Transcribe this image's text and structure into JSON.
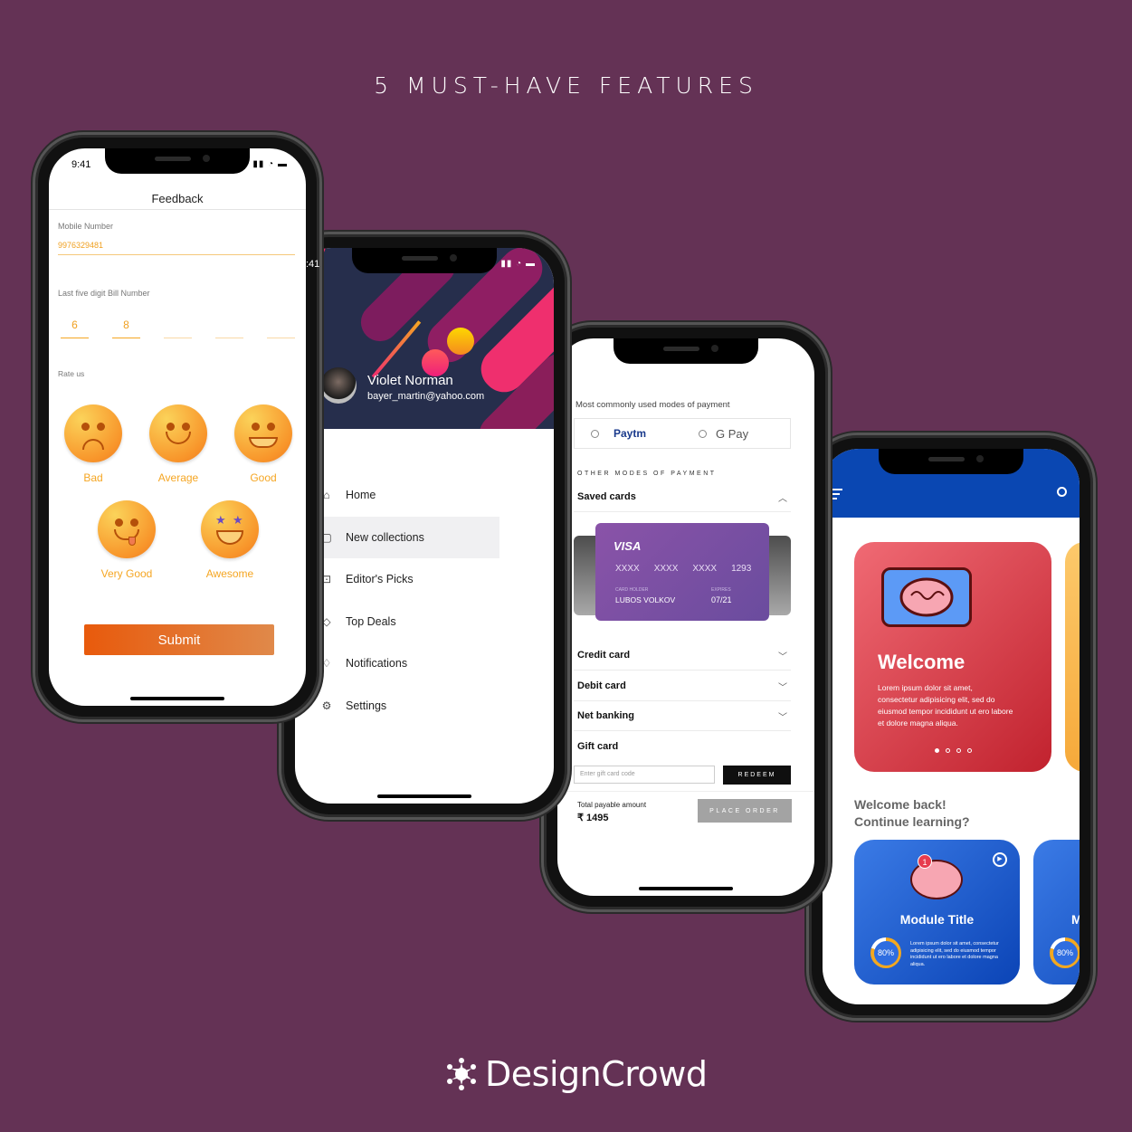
{
  "headline": "5 MUST-HAVE FEATURES",
  "brand": {
    "name": "DesignCrowd",
    "logo_icon": "starburst-people-icon"
  },
  "phone1": {
    "status_time": "9:41",
    "title": "Feedback",
    "mobile_label": "Mobile Number",
    "mobile_value": "9976329481",
    "bill_label": "Last five digit Bill Number",
    "bill_digits": [
      "6",
      "8",
      "",
      "",
      ""
    ],
    "rate_label": "Rate us",
    "ratings": [
      {
        "label": "Bad",
        "icon": "sad-face-icon"
      },
      {
        "label": "Average",
        "icon": "smile-face-icon"
      },
      {
        "label": "Good",
        "icon": "grin-face-icon"
      },
      {
        "label": "Very Good",
        "icon": "tongue-face-icon"
      },
      {
        "label": "Awesome",
        "icon": "star-eyes-face-icon"
      }
    ],
    "submit_label": "Submit",
    "accent": "#f5a623"
  },
  "phone2": {
    "status_time": ":41",
    "user_name": "Violet Norman",
    "user_email": "bayer_martin@yahoo.com",
    "menu": [
      {
        "label": "Home",
        "icon": "home-icon",
        "selected": false
      },
      {
        "label": "New collections",
        "icon": "sticky-note-icon",
        "selected": true
      },
      {
        "label": "Editor's Picks",
        "icon": "inbox-star-icon",
        "selected": false
      },
      {
        "label": "Top Deals",
        "icon": "tag-icon",
        "selected": false
      },
      {
        "label": "Notifications",
        "icon": "bell-icon",
        "selected": false
      },
      {
        "label": "Settings",
        "icon": "gear-icon",
        "selected": false
      }
    ]
  },
  "phone3": {
    "common_label": "Most commonly used modes of payment",
    "quick_options": [
      "Paytm",
      "G Pay"
    ],
    "other_label": "OTHER MODES OF PAYMENT",
    "saved_cards_label": "Saved cards",
    "card": {
      "brand": "VISA",
      "number": [
        "XXXX",
        "XXXX",
        "XXXX",
        "1293"
      ],
      "holder_label": "CARD HOLDER",
      "holder": "LUBOS VOLKOV",
      "expires_label": "EXPIRES",
      "expires": "07/21"
    },
    "sections": [
      "Credit card",
      "Debit card",
      "Net banking"
    ],
    "gift_label": "Gift card",
    "gift_placeholder": "Enter gift card code",
    "redeem_label": "REDEEM",
    "total_label": "Total payable amount",
    "total_value": "₹ 1495",
    "place_order_label": "PLACE ORDER"
  },
  "phone4": {
    "welcome_title": "Welcome",
    "welcome_text": "Lorem ipsum dolor sit amet, consectetur adipisicing elit, sed do eiusmod tempor incididunt ut ero labore et dolore magna aliqua.",
    "carousel_pages": 4,
    "carousel_active": 1,
    "continue_line1": "Welcome back!",
    "continue_line2": "Continue learning?",
    "modules": [
      {
        "title": "Module Title",
        "badge": "1",
        "progress": "80%",
        "text": "Lorem ipsum dolor sit amet, consectetur adipisicing elit, sed do eiusmod tempor incididunt ut ero labore et dolore magna aliqua."
      },
      {
        "title": "M",
        "progress": "80%"
      }
    ]
  }
}
